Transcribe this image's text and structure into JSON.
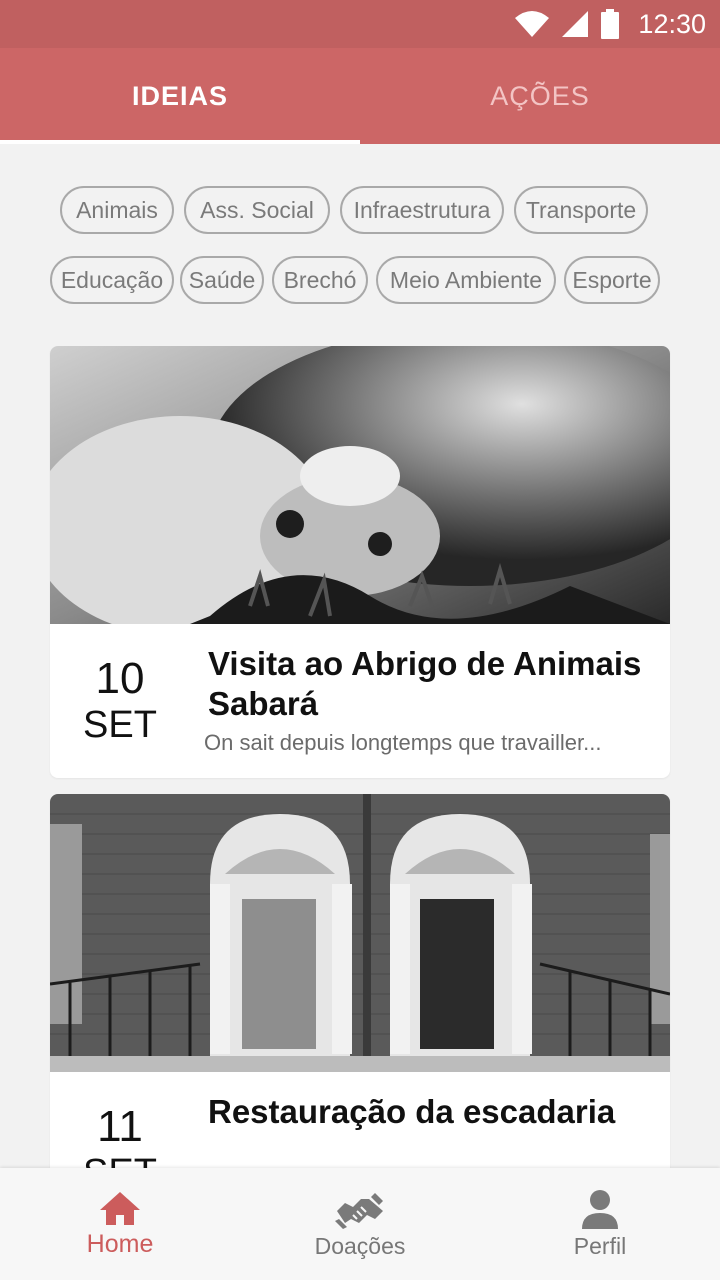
{
  "status_bar": {
    "time": "12:30",
    "icons": [
      "wifi-icon",
      "signal-icon",
      "battery-icon"
    ]
  },
  "tabs": [
    {
      "label": "IDEIAS",
      "active": true
    },
    {
      "label": "AÇÕES",
      "active": false
    }
  ],
  "categories": [
    "Animais",
    "Ass. Social",
    "Infraestrutura",
    "Transporte",
    "Educação",
    "Saúde",
    "Brechó",
    "Meio Ambiente",
    "Esporte"
  ],
  "cards": [
    {
      "day": "10",
      "month": "SET",
      "title": "Visita ao Abrigo de Animais Sabará",
      "description": "On sait depuis longtemps que travailler...",
      "image": "cat-and-dog-photo"
    },
    {
      "day": "11",
      "month": "SET",
      "title": "Restauração da escadaria",
      "description": "",
      "image": "georgian-doors-photo"
    }
  ],
  "bottom_nav": [
    {
      "label": "Home",
      "icon": "home-icon",
      "active": true
    },
    {
      "label": "Doações",
      "icon": "handshake-icon",
      "active": false
    },
    {
      "label": "Perfil",
      "icon": "person-icon",
      "active": false
    }
  ],
  "colors": {
    "primary": "#cc6666",
    "status_bar": "#c06060",
    "active_nav": "#cc5c5c",
    "background": "#f2f2f2"
  }
}
